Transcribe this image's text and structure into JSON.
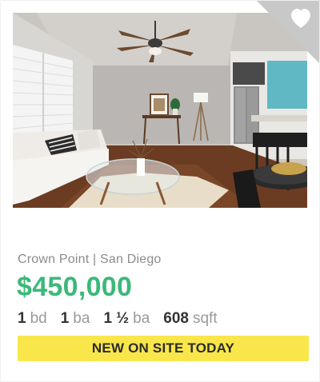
{
  "listing": {
    "location": "Crown Point | San Diego",
    "price": "$450,000",
    "beds": {
      "value": "1",
      "unit": "bd"
    },
    "baths": {
      "value": "1",
      "unit": "ba"
    },
    "half_baths": {
      "value": "1 ½",
      "unit": "ba"
    },
    "sqft": {
      "value": "608",
      "unit": "sqft"
    },
    "badge": "NEW ON SITE TODAY",
    "photo_description_icon": "living-room-photo",
    "favorite_icon": "heart-icon"
  },
  "colors": {
    "price": "#3cb879",
    "badge_bg": "#f9e64b",
    "favorite_corner": "#c8c8c8"
  }
}
